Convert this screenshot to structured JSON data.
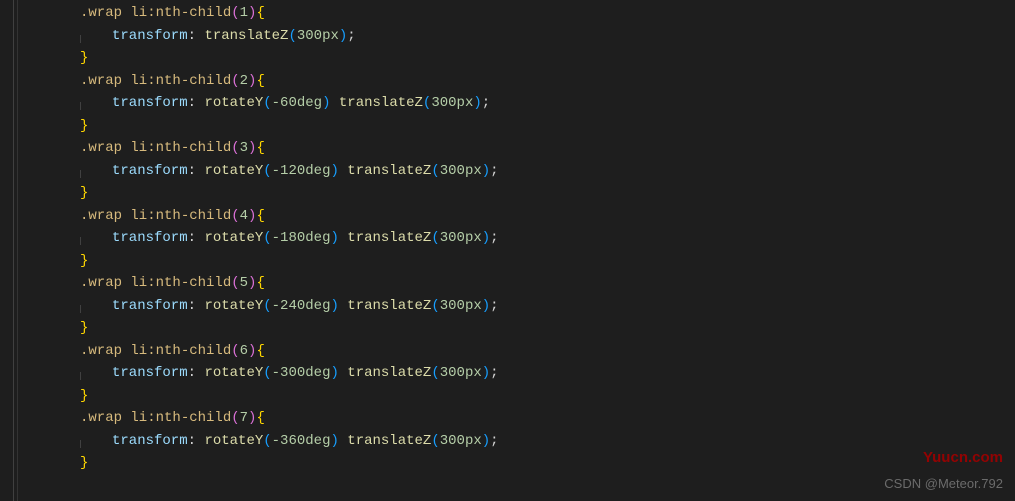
{
  "rules": [
    {
      "n": "1",
      "transforms": [
        "translateZ(300px)"
      ]
    },
    {
      "n": "2",
      "transforms": [
        "rotateY(-60deg)",
        "translateZ(300px)"
      ]
    },
    {
      "n": "3",
      "transforms": [
        "rotateY(-120deg)",
        "translateZ(300px)"
      ]
    },
    {
      "n": "4",
      "transforms": [
        "rotateY(-180deg)",
        "translateZ(300px)"
      ]
    },
    {
      "n": "5",
      "transforms": [
        "rotateY(-240deg)",
        "translateZ(300px)"
      ]
    },
    {
      "n": "6",
      "transforms": [
        "rotateY(-300deg)",
        "translateZ(300px)"
      ]
    },
    {
      "n": "7",
      "transforms": [
        "rotateY(-360deg)",
        "translateZ(300px)"
      ]
    }
  ],
  "selector_prefix": ".wrap li",
  "pseudo": ":nth-child",
  "property": "transform",
  "watermarks": {
    "w1": "Yuucn.com",
    "w2": "CSDN @Meteor.792"
  }
}
